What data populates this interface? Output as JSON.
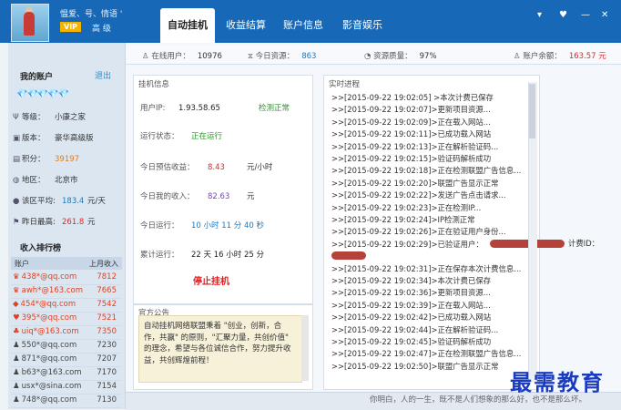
{
  "user": {
    "name": "愠爱、号、情语 '",
    "vip": "VIP",
    "level": "高 级"
  },
  "tabs": [
    "自动挂机",
    "收益结算",
    "账户信息",
    "影音娱乐"
  ],
  "window_controls": [
    "▾",
    "♥",
    "—",
    "✕"
  ],
  "stats": {
    "online_label": "在线用户：",
    "online_value": "10976",
    "resource_label": "今日资源：",
    "resource_value": "863",
    "quality_label": "资源质量：",
    "quality_value": "97%",
    "balance_label": "账户余额：",
    "balance_value": "163.57 元"
  },
  "account": {
    "title": "我的账户",
    "logout": "退出",
    "diamonds": "💎💎💎💎💎",
    "rows": [
      {
        "icon": "Ψ",
        "label": "等级：",
        "value": "小康之家",
        "color": "#222"
      },
      {
        "icon": "▣",
        "label": "版本：",
        "value": "豪华高级版",
        "color": "#222"
      },
      {
        "icon": "▤",
        "label": "积分：",
        "value": "39197",
        "color": "#e07a20"
      },
      {
        "icon": "◍",
        "label": "地区：",
        "value": "北京市",
        "color": "#222"
      },
      {
        "icon": "●",
        "label": "该区平均:",
        "value": "183.4",
        "unit": "元/天",
        "color": "#1a78c2"
      },
      {
        "icon": "⚑",
        "label": "昨日最高:",
        "value": "261.8",
        "unit": "元",
        "color": "#d82a2a"
      }
    ]
  },
  "ranking": {
    "title": "收入排行榜",
    "headers": [
      "账户",
      "上月收入"
    ],
    "rows": [
      {
        "icon": "♛",
        "account": "438*@qq.com",
        "amount": "7812",
        "color": "#e04020"
      },
      {
        "icon": "♛",
        "account": "awh*@163.com",
        "amount": "7665",
        "color": "#e04020"
      },
      {
        "icon": "◆",
        "account": "454*@qq.com",
        "amount": "7542",
        "color": "#e04020"
      },
      {
        "icon": "♥",
        "account": "395*@qq.com",
        "amount": "7521",
        "color": "#e04020"
      },
      {
        "icon": "♣",
        "account": "uiq*@163.com",
        "amount": "7350",
        "color": "#e04020"
      },
      {
        "icon": "♟",
        "account": "550*@qq.com",
        "amount": "7230",
        "color": "#444"
      },
      {
        "icon": "♟",
        "account": "871*@qq.com",
        "amount": "7207",
        "color": "#444"
      },
      {
        "icon": "♟",
        "account": "b63*@163.com",
        "amount": "7170",
        "color": "#444"
      },
      {
        "icon": "♟",
        "account": "usx*@sina.com",
        "amount": "7154",
        "color": "#444"
      },
      {
        "icon": "♟",
        "account": "748*@qq.com",
        "amount": "7130",
        "color": "#444"
      }
    ]
  },
  "hang": {
    "title": "挂机信息",
    "ip_label": "用户IP:",
    "ip_value": "1.93.58.65",
    "ip_status": "检测正常",
    "state_label": "运行状态：",
    "state_value": "正在运行",
    "forecast_label": "今日预估收益：",
    "forecast_value": "8.43",
    "forecast_unit": "元/小时",
    "income_label": "今日我的收入：",
    "income_value": "82.63",
    "income_unit": "元",
    "runtime_label": "今日运行：",
    "runtime_value": "10 小时 11 分 40 秒",
    "total_label": "累计运行：",
    "total_value": "22 天 16 小时 25 分",
    "stop": "停止挂机"
  },
  "notice": {
    "title": "官方公告",
    "text": "自动挂机网络联盟秉着 \"创业，创新，合作，共赢\" 的原则，\"汇聚力量，共创价值\" 的理念，希望与各位诚信合作，努力提升收益，共创辉煌前程！"
  },
  "log": {
    "title": "实时进程",
    "lines": [
      ">>[2015-09-22 19:02:05] >本次计费已保存",
      ">>[2015-09-22 19:02:07]>更新项目资源...",
      ">>[2015-09-22 19:02:09]>正在载入网站...",
      ">>[2015-09-22 19:02:11]>已成功载入网站",
      ">>[2015-09-22 19:02:13]>正在解析验证码...",
      ">>[2015-09-22 19:02:15]>验证码解析成功",
      ">>[2015-09-22 19:02:18]>正在检测联盟广告信息...",
      ">>[2015-09-22 19:02:20]>联盟广告显示正常",
      ">>[2015-09-22 19:02:22]>发送广告点击请求...",
      ">>[2015-09-22 19:02:23]>正在检测IP...",
      ">>[2015-09-22 19:02:24]>IP检测正常",
      ">>[2015-09-22 19:02:26]>正在验证用户身份...",
      ">>[2015-09-22 19:02:29]>已验证用户：",
      "",
      ">>[2015-09-22 19:02:31]>正在保存本次计费信息...",
      ">>[2015-09-22 19:02:34]>本次计费已保存",
      ">>[2015-09-22 19:02:36]>更新项目资源...",
      ">>[2015-09-22 19:02:39]>正在载入网站...",
      ">>[2015-09-22 19:02:42]>已成功载入网站",
      ">>[2015-09-22 19:02:44]>正在解析验证码...",
      ">>[2015-09-22 19:02:45]>验证码解析成功",
      ">>[2015-09-22 19:02:47]>正在检测联盟广告信息...",
      ">>[2015-09-22 19:02:50]>联盟广告显示正常"
    ],
    "billing_label": "计费ID："
  },
  "footer": {
    "marquee": "你明白，人的一生，既不是人们想象的那么好，也不是那么坏。"
  },
  "watermark": "最需教育"
}
